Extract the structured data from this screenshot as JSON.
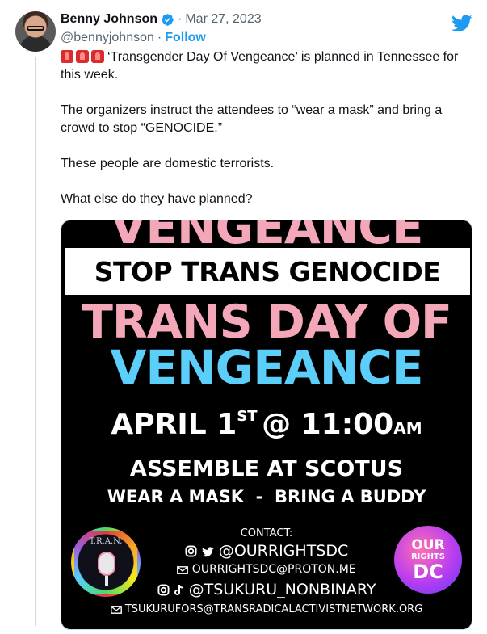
{
  "tweet": {
    "author_name": "Benny Johnson",
    "date_sep": "·",
    "date": "Mar 27, 2023",
    "handle": "@bennyjohnson",
    "handle_sep": "·",
    "follow_label": "Follow",
    "verified_icon": "verified-badge-icon",
    "platform_icon": "twitter-bird-icon",
    "paragraphs": [
      "‘Transgender Day Of Vengeance’ is planned in Tennessee for this week.",
      "The organizers instruct the attendees to “wear a mask” and bring a crowd to stop “GENOCIDE.”",
      "These people are domestic terrorists.",
      "What else do they have planned?"
    ],
    "emoji": [
      "siren-emoji",
      "siren-emoji",
      "siren-emoji"
    ]
  },
  "poster": {
    "top_cut": "VENGEANCE",
    "banner": "STOP TRANS GENOCIDE",
    "line_pink": "TRANS DAY OF",
    "line_blue": "VENGEANCE",
    "date_main": "APRIL 1",
    "date_sup": "ST",
    "date_at": "@ 11:00",
    "date_ampm": "AM",
    "assemble": "ASSEMBLE AT SCOTUS",
    "instructions": "WEAR A MASK  -  BRING A BUDDY",
    "contact_label": "CONTACT:",
    "social_1": "@OURRIGHTSDC",
    "email_1": "OURRIGHTSDC@PROTON.ME",
    "social_2": "@TSUKURU_NONBINARY",
    "email_2": "TSUKURUFORS@TRANSRADICALACTIVISTNETWORK.ORG",
    "logo_left_text": "T.R.A.N.",
    "logo_right_our": "OUR",
    "logo_right_rights": "RIGHTS",
    "logo_right_dc": "DC",
    "colors": {
      "pink": "#f4a7b9",
      "blue": "#5bcefa",
      "background": "#000000"
    }
  },
  "theme": {
    "link": "#1d9bf0",
    "muted": "#536471",
    "text": "#0f1419"
  }
}
